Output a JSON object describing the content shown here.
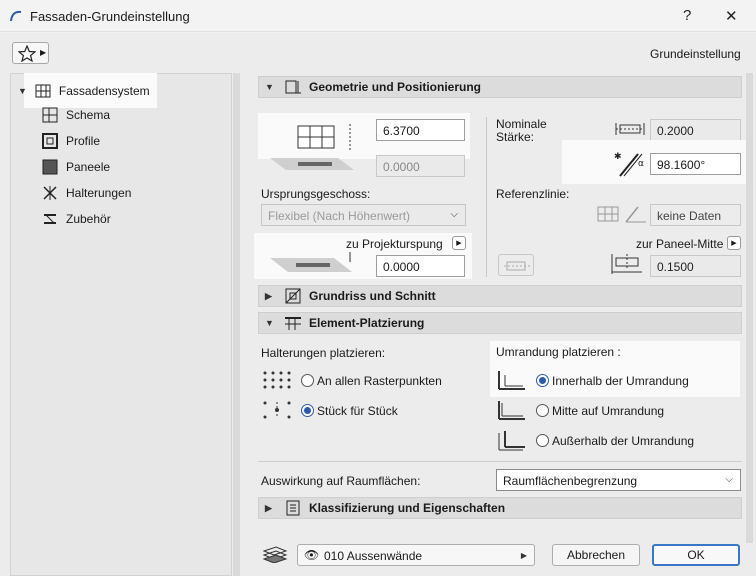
{
  "window": {
    "title": "Fassaden-Grundeinstellung",
    "help": "?",
    "close": "✕"
  },
  "header": {
    "preset_label": "Grundeinstellung"
  },
  "tree": {
    "root": "Fassadensystem",
    "items": [
      "Schema",
      "Profile",
      "Paneele",
      "Halterungen",
      "Zubehör"
    ]
  },
  "geometry": {
    "title": "Geometrie und Positionierung",
    "height_value": "6.3700",
    "offset_value": "0.0000",
    "origin_story_label": "Ursprungsgeschoss:",
    "origin_story_value": "Flexibel (Nach Höhenwert)",
    "project_origin_label": "zu Projekturspung",
    "project_origin_value": "0.0000",
    "nominal_label_1": "Nominale",
    "nominal_label_2": "Stärke:",
    "thickness_value": "0.2000",
    "angle_value": "98.1600°",
    "reference_label": "Referenzlinie:",
    "reference_value": "keine Daten",
    "panel_center_label": "zur Paneel-Mitte",
    "panel_center_value": "0.1500"
  },
  "sections": {
    "floorplan": "Grundriss und Schnitt",
    "placement": "Element-Platzierung",
    "classification": "Klassifizierung und Eigenschaften"
  },
  "placement": {
    "mounts_label": "Halterungen platzieren:",
    "mount_opt_1": "An allen Rasterpunkten",
    "mount_opt_2": "Stück für Stück",
    "mount_selected": 2,
    "border_label": "Umrandung platzieren :",
    "border_opt_1": "Innerhalb der Umrandung",
    "border_opt_2": "Mitte auf Umrandung",
    "border_opt_3": "Außerhalb der Umrandung",
    "border_selected": 1
  },
  "zones": {
    "label": "Auswirkung auf Raumflächen:",
    "value": "Raumflächenbegrenzung"
  },
  "footer": {
    "layer": "010 Aussenwände",
    "cancel": "Abbrechen",
    "ok": "OK"
  }
}
